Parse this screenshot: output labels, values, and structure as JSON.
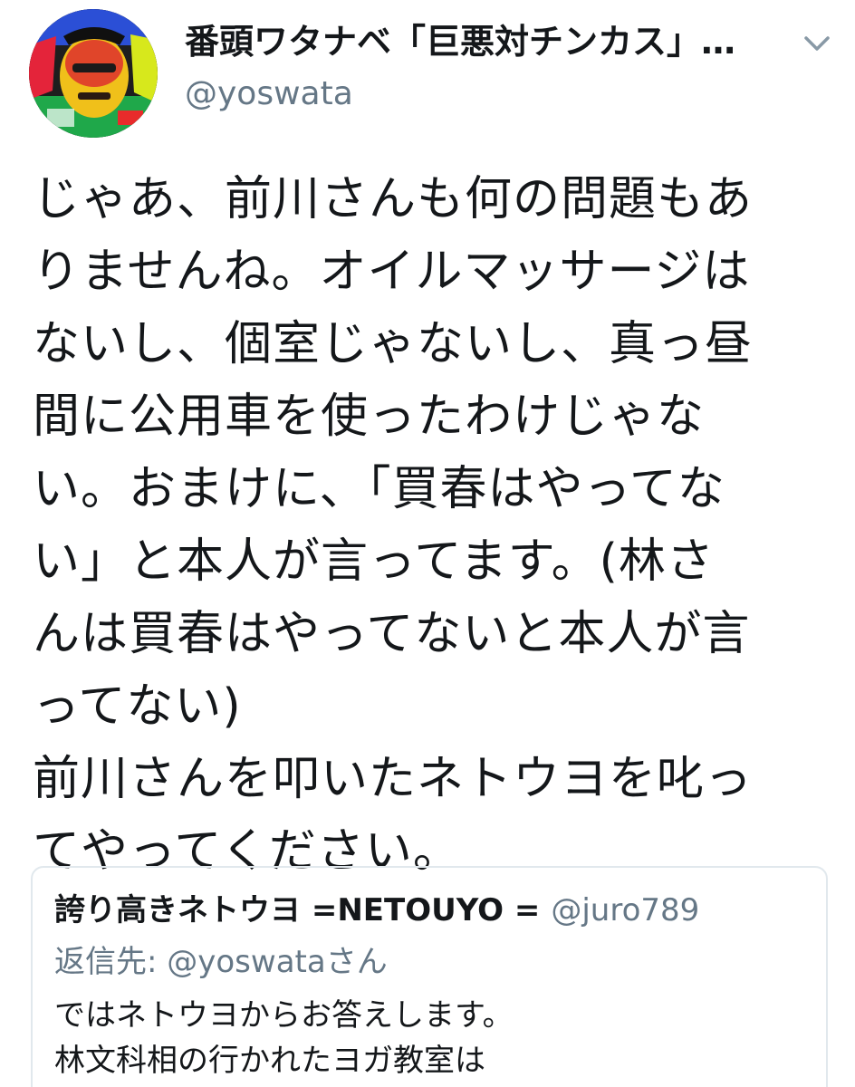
{
  "tweet": {
    "author": {
      "name": "番頭ワタナベ「巨悪対チンカス」…",
      "handle": "@yoswata",
      "avatar_icon": "avatar-photo"
    },
    "menu_icon": "chevron-down-icon",
    "body_lines": [
      "じゃあ、前川さんも何の問題もあ",
      "りませんね。オイルマッサージは",
      "ないし、個室じゃないし、真っ昼",
      "間に公用車を使ったわけじゃな",
      "い。おまけに、「買春はやってな",
      "い」と本人が言ってます。(林さ",
      "んは買春はやってないと本人が言",
      "ってない)",
      "前川さんを叩いたネトウヨを叱っ",
      "てやってください。"
    ],
    "quoted": {
      "name": "誇り高きネトウヨ =NETOUYO =",
      "handle": "@juro789",
      "reply_to": "返信先: @yoswataさん",
      "text_lines": [
        "ではネトウヨからお答えします。",
        "林文科相の行かれたヨガ教室は"
      ]
    }
  },
  "colors": {
    "text": "#14171a",
    "secondary": "#657786",
    "border": "#e1e8ed",
    "caret": "#8899a6"
  }
}
